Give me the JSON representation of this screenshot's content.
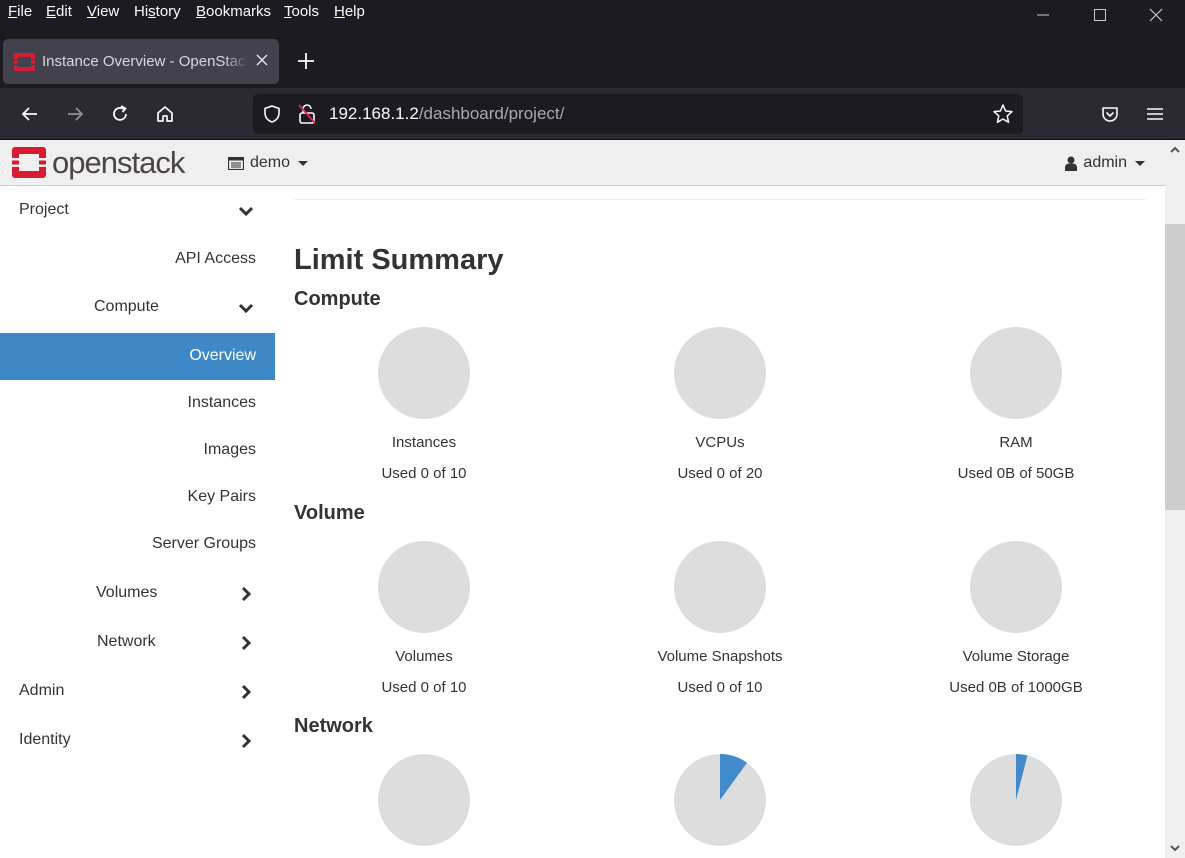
{
  "browser": {
    "menu": [
      {
        "label": "File",
        "accel": "F",
        "rest": "ile"
      },
      {
        "label": "Edit",
        "accel": "E",
        "rest": "dit"
      },
      {
        "label": "View",
        "accel": "V",
        "rest": "iew"
      },
      {
        "label": "History",
        "pre": "Hi",
        "accel": "s",
        "rest": "tory"
      },
      {
        "label": "Bookmarks",
        "accel": "B",
        "rest": "ookmarks"
      },
      {
        "label": "Tools",
        "accel": "T",
        "rest": "ools"
      },
      {
        "label": "Help",
        "accel": "H",
        "rest": "elp"
      }
    ],
    "tab_title": "Instance Overview - OpenStack Dashboard",
    "url_host": "192.168.1.2",
    "url_path": "/dashboard/project/"
  },
  "header": {
    "brand": "openstack",
    "project": "demo",
    "user": "admin"
  },
  "sidebar": {
    "items": [
      {
        "label": "Project",
        "level": 0,
        "chevron": "down"
      },
      {
        "label": "API Access",
        "level": 2
      },
      {
        "label": "Compute",
        "level": 1,
        "chevron": "down"
      },
      {
        "label": "Overview",
        "level": 2,
        "active": true
      },
      {
        "label": "Instances",
        "level": 2
      },
      {
        "label": "Images",
        "level": 2
      },
      {
        "label": "Key Pairs",
        "level": 2
      },
      {
        "label": "Server Groups",
        "level": 2
      },
      {
        "label": "Volumes",
        "level": 1,
        "chevron": "right"
      },
      {
        "label": "Network",
        "level": 1,
        "chevron": "right"
      },
      {
        "label": "Admin",
        "level": 0,
        "chevron": "right"
      },
      {
        "label": "Identity",
        "level": 0,
        "chevron": "right"
      }
    ]
  },
  "main": {
    "title": "Limit Summary",
    "sections": [
      {
        "name": "Compute",
        "quotas": [
          {
            "label": "Instances",
            "usage": "Used 0 of 10",
            "used": 0,
            "limit": 10
          },
          {
            "label": "VCPUs",
            "usage": "Used 0 of 20",
            "used": 0,
            "limit": 20
          },
          {
            "label": "RAM",
            "usage": "Used 0B of 50GB",
            "used": 0,
            "limit": 50
          }
        ]
      },
      {
        "name": "Volume",
        "quotas": [
          {
            "label": "Volumes",
            "usage": "Used 0 of 10",
            "used": 0,
            "limit": 10
          },
          {
            "label": "Volume Snapshots",
            "usage": "Used 0 of 10",
            "used": 0,
            "limit": 10
          },
          {
            "label": "Volume Storage",
            "usage": "Used 0B of 1000GB",
            "used": 0,
            "limit": 1000
          }
        ]
      },
      {
        "name": "Network",
        "quotas": [
          {
            "label": "",
            "usage": "",
            "fraction": 0.0
          },
          {
            "label": "",
            "usage": "",
            "fraction": 0.1
          },
          {
            "label": "",
            "usage": "",
            "fraction": 0.04
          }
        ]
      }
    ]
  },
  "colors": {
    "pie_used": "#428bca",
    "pie_free": "#dddddd",
    "active_nav": "#3f88c8",
    "logo_red": "#da1a32"
  }
}
